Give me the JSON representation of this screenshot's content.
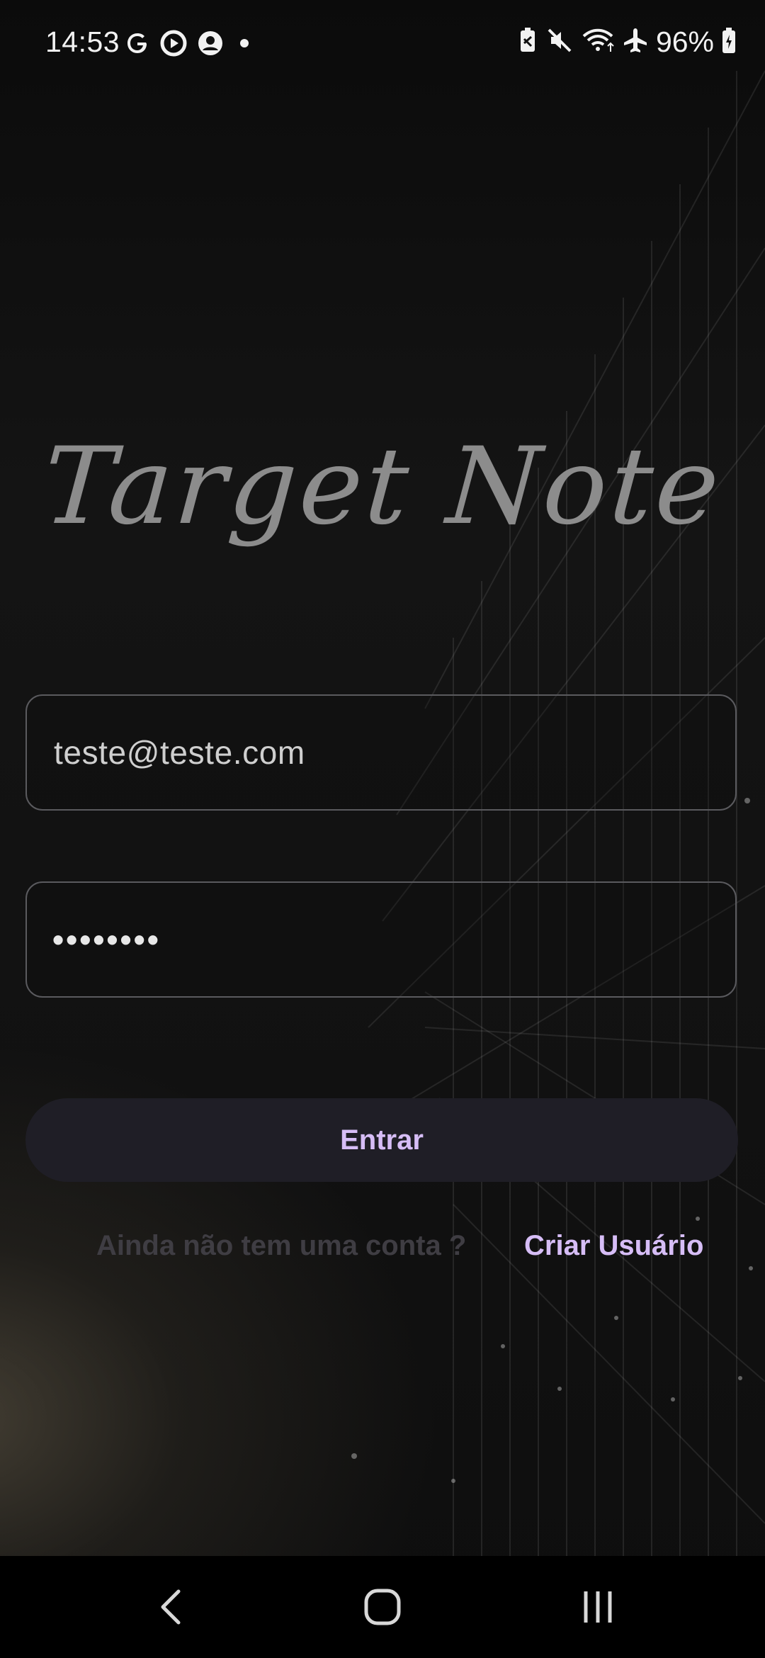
{
  "status_bar": {
    "time": "14:53",
    "left_icons": [
      "google-icon",
      "play-circle-icon",
      "account-circle-icon",
      "notification-dot-icon"
    ],
    "right_icons": [
      "battery-saver-icon",
      "mute-icon",
      "wifi-icon",
      "airplane-mode-icon"
    ],
    "battery_level": "96%"
  },
  "app": {
    "title": "Target Note"
  },
  "form": {
    "email": {
      "value": "teste@teste.com"
    },
    "password": {
      "masked_value": "••••••••"
    },
    "login_button_label": "Entrar",
    "signup_prompt": "Ainda não tem uma conta ?",
    "signup_link_label": "Criar Usuário"
  },
  "navigation_bar": {
    "buttons": [
      "back-icon",
      "home-icon",
      "recents-icon"
    ]
  },
  "colors": {
    "accent": "#d6bdf6",
    "button_bg": "#1f1e26",
    "title": "#8c8c8c",
    "field_border": "#5a5a5e",
    "muted_text": "#3f3d43"
  }
}
